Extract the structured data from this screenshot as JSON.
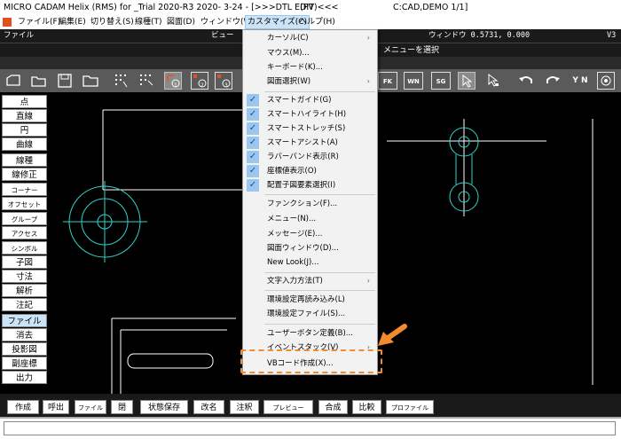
{
  "titlebar": {
    "title": "MICRO CADAM Helix (RMS) for _Trial 2020-R3 2020- 3-24 - [>>>DTL EDIT",
    "pv": "(PV)<<<",
    "path": "C:CAD,DEMO      1/1]"
  },
  "menubar": {
    "items": [
      "ファイル(F)",
      "編集(E)",
      "切り替え(S)",
      "線種(T)",
      "図面(D)",
      "ウィンドウ(W)",
      "カスタマイズ(C)",
      "ヘルプ(H)"
    ],
    "active": "カスタマイズ(C)"
  },
  "statusbar": {
    "mode": "ファイル",
    "view": "ビュー",
    "window": "ウィンドウ 0.5731, 0.000",
    "version": "V3"
  },
  "message": "メニューを選択",
  "toolbar": {
    "text_buttons": [
      "FK",
      "WN",
      "SG"
    ],
    "yn": "Y N",
    "step_labels": [
      "1",
      "2",
      "3"
    ]
  },
  "sidebar": {
    "items": [
      "点",
      "直線",
      "円",
      "曲線",
      "線種",
      "線修正",
      "コーナー",
      "オフセット",
      "グループ",
      "アクセス",
      "シンボル",
      "子図",
      "寸法",
      "解析",
      "注記",
      "ファイル",
      "消去",
      "投影図",
      "副座標",
      "出力"
    ],
    "active": "ファイル"
  },
  "bottombar": {
    "buttons": [
      "作成",
      "呼出",
      "ファイル",
      "閉",
      "状態保存",
      "改名",
      "注釈",
      "プレビュー",
      "合成",
      "比較",
      "プロファイル"
    ]
  },
  "cmdline": {
    "value": ""
  },
  "dropdown": {
    "items": [
      {
        "label": "カーソル(C)",
        "submenu": true,
        "checked": false
      },
      {
        "label": "マウス(M)...",
        "submenu": false,
        "checked": false
      },
      {
        "label": "キーボード(K)...",
        "submenu": false,
        "checked": false
      },
      {
        "label": "図面選択(W)",
        "submenu": true,
        "checked": false
      },
      {
        "label": "スマートガイド(G)",
        "submenu": false,
        "checked": true
      },
      {
        "label": "スマートハイライト(H)",
        "submenu": false,
        "checked": true
      },
      {
        "label": "スマートストレッチ(S)",
        "submenu": false,
        "checked": true
      },
      {
        "label": "スマートアシスト(A)",
        "submenu": false,
        "checked": true
      },
      {
        "label": "ラバーバンド表示(R)",
        "submenu": false,
        "checked": true
      },
      {
        "label": "座標値表示(O)",
        "submenu": false,
        "checked": true
      },
      {
        "label": "配置子図要素選択(I)",
        "submenu": false,
        "checked": true
      },
      {
        "label": "ファンクション(F)...",
        "submenu": false,
        "checked": false
      },
      {
        "label": "メニュー(N)...",
        "submenu": false,
        "checked": false
      },
      {
        "label": "メッセージ(E)...",
        "submenu": false,
        "checked": false
      },
      {
        "label": "図面ウィンドウ(D)...",
        "submenu": false,
        "checked": false
      },
      {
        "label": "New Look(J)...",
        "submenu": false,
        "checked": false
      },
      {
        "label": "文字入力方法(T)",
        "submenu": true,
        "checked": false
      },
      {
        "label": "環境設定再読み込み(L)",
        "submenu": false,
        "checked": false
      },
      {
        "label": "環境設定ファイル(S)...",
        "submenu": false,
        "checked": false
      },
      {
        "label": "ユーザーボタン定義(B)...",
        "submenu": false,
        "checked": false
      },
      {
        "label": "イベントスタック(V)",
        "submenu": true,
        "checked": false
      },
      {
        "label": "VBコード作成(X)...",
        "submenu": false,
        "checked": false
      }
    ]
  },
  "colors": {
    "accent": "#f28a2e",
    "canvas_line": "#2fd3c9",
    "check_bg": "#9bc7ef"
  }
}
